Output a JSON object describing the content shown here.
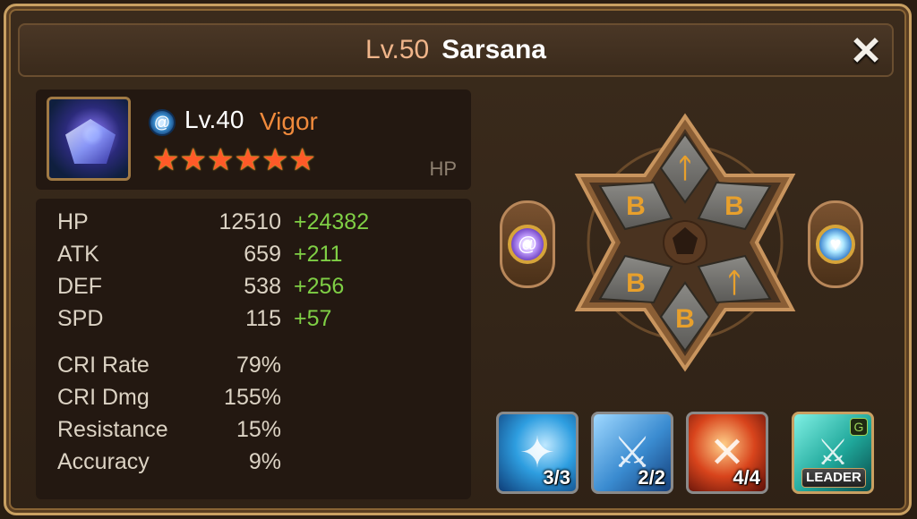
{
  "header": {
    "level": "Lv.50",
    "name": "Sarsana"
  },
  "close_icon": "✕",
  "monster": {
    "attribute_icon": "water-spiral",
    "level": "Lv.40",
    "rune_set": "Vigor",
    "stars": 6,
    "tag": "HP"
  },
  "stats": {
    "main": [
      {
        "label": "HP",
        "value": "12510",
        "bonus": "+24382"
      },
      {
        "label": "ATK",
        "value": "659",
        "bonus": "+211"
      },
      {
        "label": "DEF",
        "value": "538",
        "bonus": "+256"
      },
      {
        "label": "SPD",
        "value": "115",
        "bonus": "+57"
      }
    ],
    "secondary": [
      {
        "label": "CRI Rate",
        "value": "79%"
      },
      {
        "label": "CRI Dmg",
        "value": "155%"
      },
      {
        "label": "Resistance",
        "value": "15%"
      },
      {
        "label": "Accuracy",
        "value": "9%"
      }
    ]
  },
  "skills": [
    {
      "name": "skill-1",
      "count": "3/3",
      "color": "#2e9ee0"
    },
    {
      "name": "skill-2",
      "count": "2/2",
      "color": "#3a8bd0"
    },
    {
      "name": "skill-3",
      "count": "4/4",
      "color": "#d8441c"
    },
    {
      "name": "leader-skill",
      "label": "LEADER",
      "color": "#1fa79a"
    }
  ],
  "colors": {
    "bonus": "#7fcf45",
    "set_name": "#f08a3c",
    "level_header": "#f0b58a"
  }
}
